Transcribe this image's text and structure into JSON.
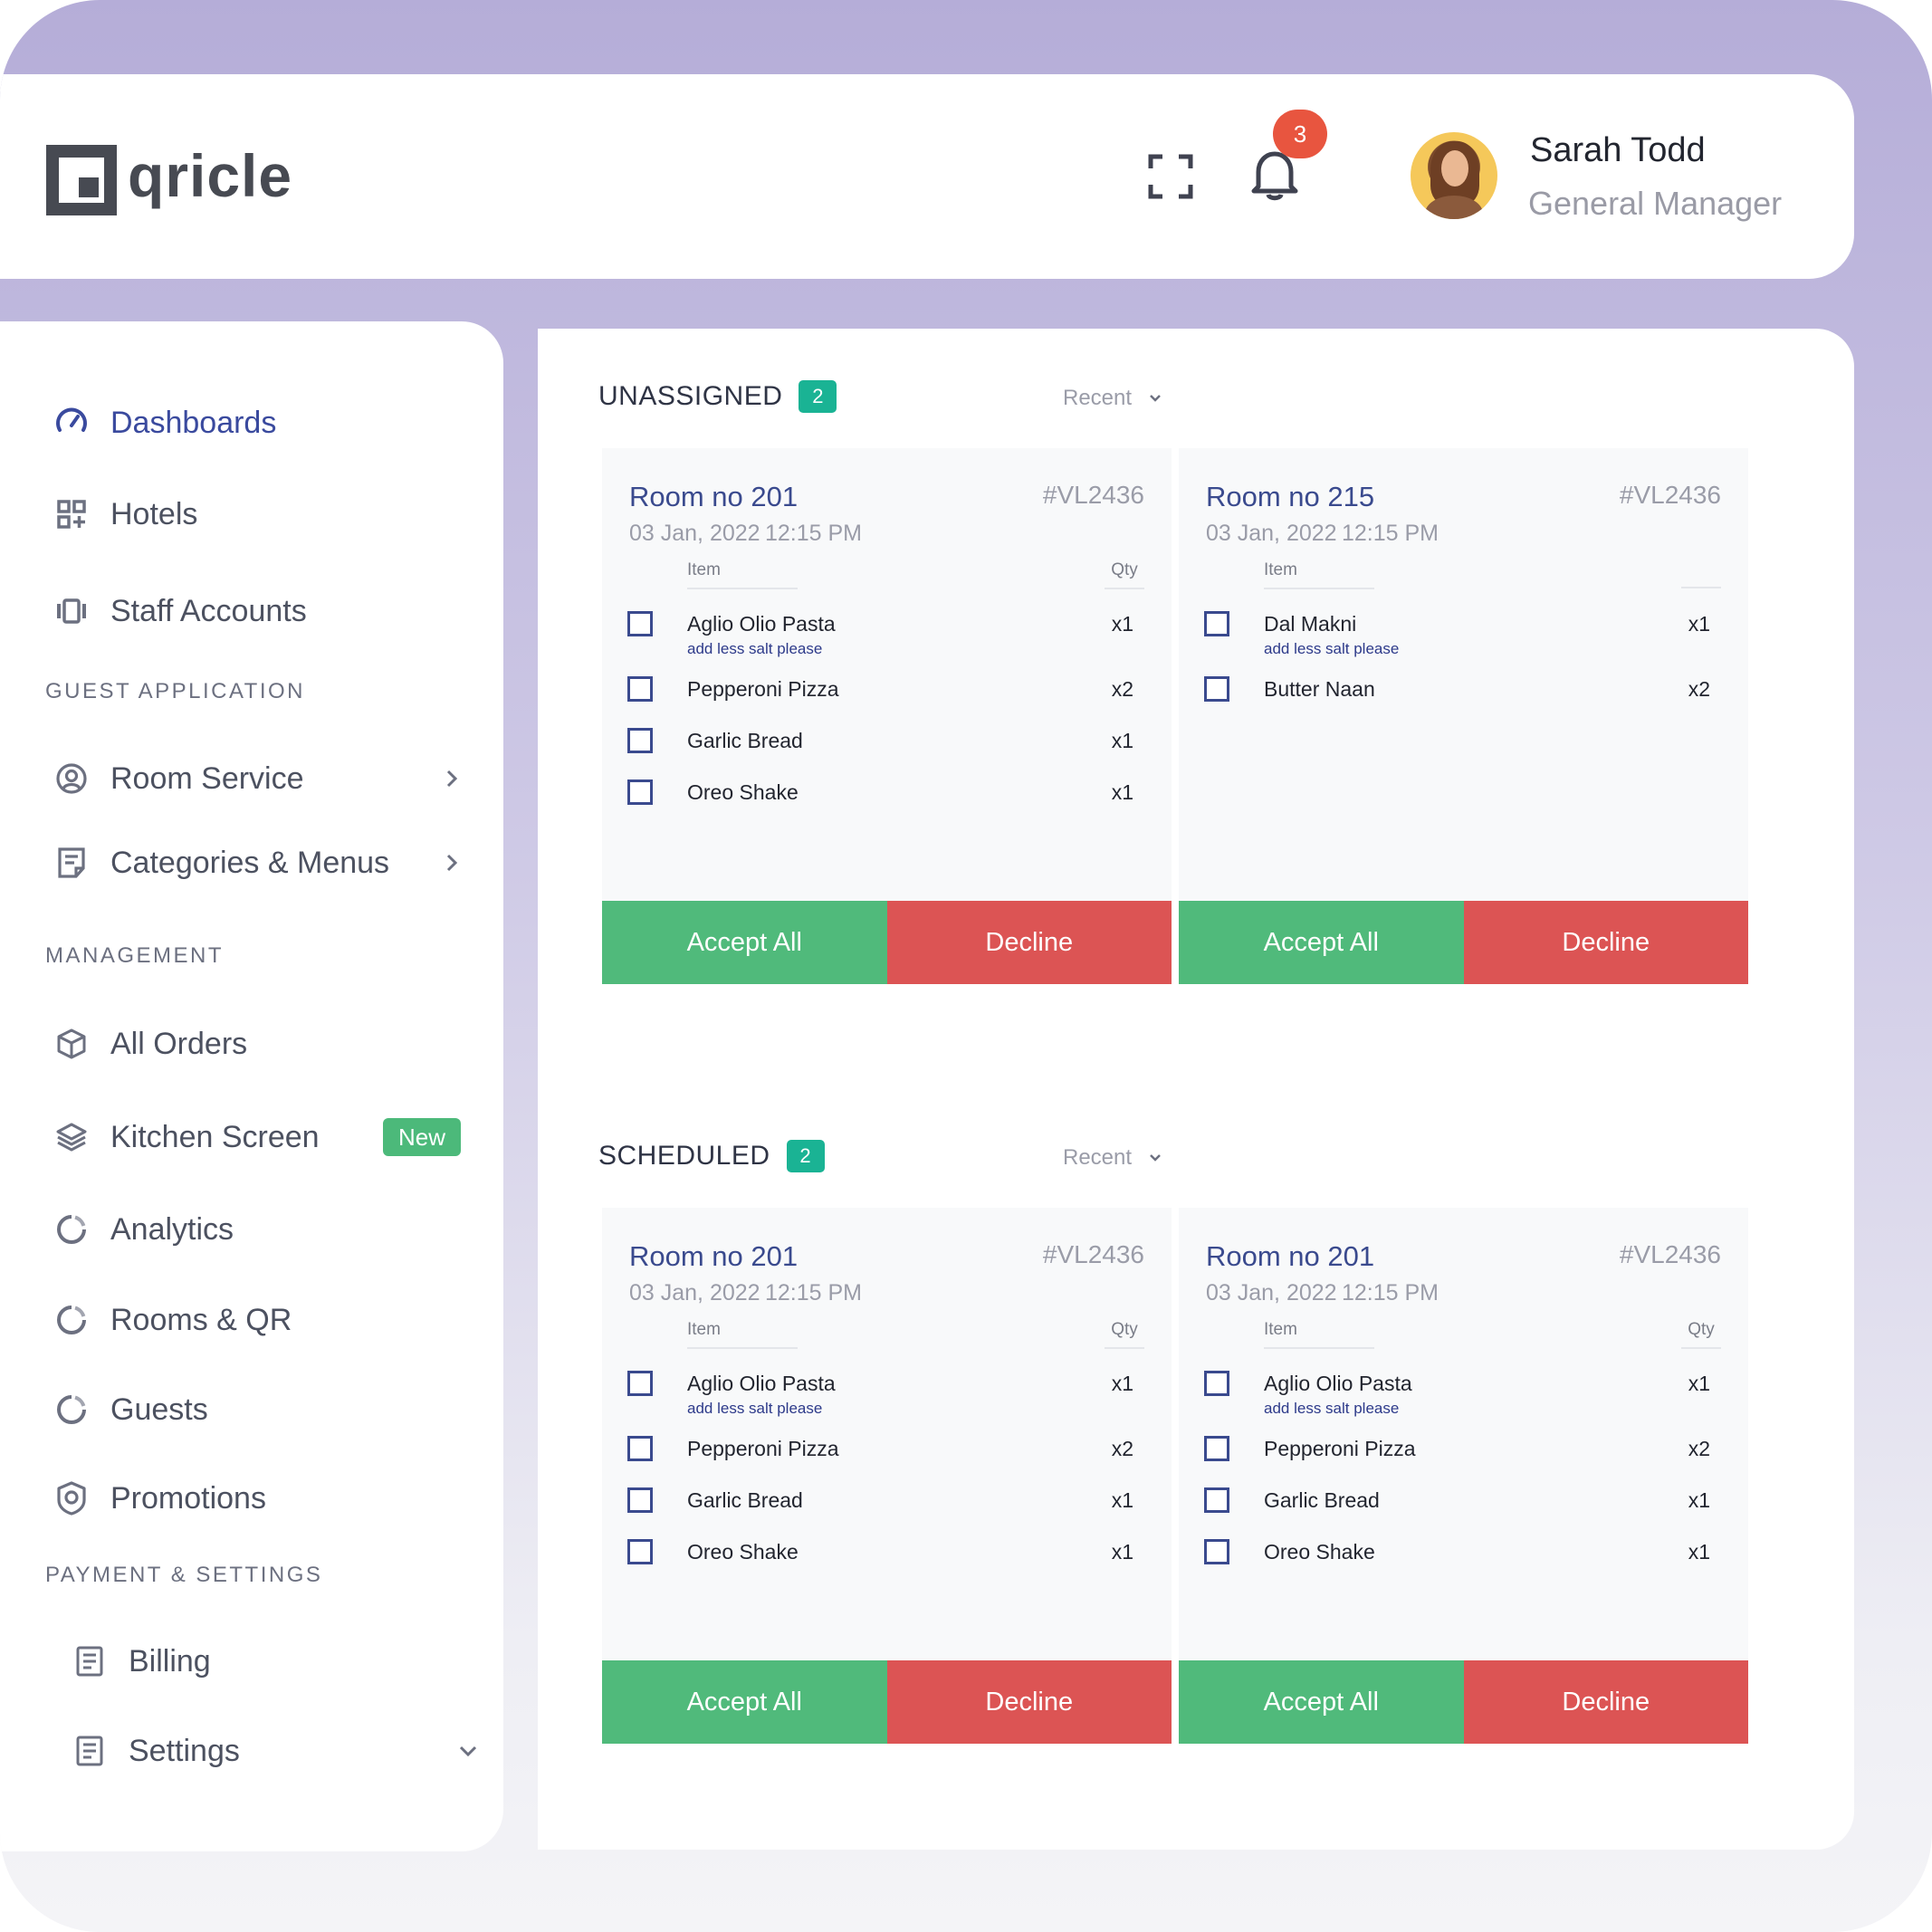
{
  "brand": {
    "name": "qricle"
  },
  "header": {
    "notification_count": "3",
    "user": {
      "name": "Sarah Todd",
      "role": "General Manager"
    }
  },
  "sidebar": {
    "items": [
      {
        "label": "Dashboards",
        "icon": "speedometer-icon",
        "active": true
      },
      {
        "label": "Hotels",
        "icon": "grid-plus-icon"
      },
      {
        "label": "Staff Accounts",
        "icon": "carousel-icon"
      },
      {
        "label": "Room Service",
        "icon": "user-circle-icon"
      },
      {
        "label": "Categories & Menus",
        "icon": "document-icon"
      },
      {
        "label": "All Orders",
        "icon": "box-icon"
      },
      {
        "label": "Kitchen Screen",
        "icon": "layers-icon",
        "badge": "New"
      },
      {
        "label": "Analytics",
        "icon": "donut-icon"
      },
      {
        "label": "Rooms & QR",
        "icon": "donut-icon"
      },
      {
        "label": "Guests",
        "icon": "donut-icon"
      },
      {
        "label": "Promotions",
        "icon": "badge-icon"
      },
      {
        "label": "Billing",
        "icon": "receipt-icon"
      },
      {
        "label": "Settings",
        "icon": "receipt-icon"
      }
    ],
    "sections": {
      "guest_application": "GUEST APPLICATION",
      "management": "MANAGEMENT",
      "payment_settings": "PAYMENT & SETTINGS"
    }
  },
  "main": {
    "sections": [
      {
        "title": "UNASSIGNED",
        "count": "2",
        "sort": "Recent",
        "orders": [
          {
            "room": "Room no 201",
            "code": "#VL2436",
            "date": "03 Jan, 2022",
            "time": "12:15 PM",
            "col_item": "Item",
            "col_qty": "Qty",
            "items": [
              {
                "name": "Aglio Olio Pasta",
                "note": "add less salt please",
                "qty": "x1"
              },
              {
                "name": "Pepperoni Pizza",
                "qty": "x2"
              },
              {
                "name": "Garlic Bread",
                "qty": "x1"
              },
              {
                "name": "Oreo Shake",
                "qty": "x1"
              }
            ],
            "accept": "Accept All",
            "decline": "Decline"
          },
          {
            "room": "Room no 215",
            "code": "#VL2436",
            "date": "03 Jan, 2022",
            "time": "12:15 PM",
            "col_item": "Item",
            "col_qty": "",
            "items": [
              {
                "name": "Dal Makni",
                "note": "add less salt please",
                "qty": "x1"
              },
              {
                "name": "Butter Naan",
                "qty": "x2"
              }
            ],
            "accept": "Accept All",
            "decline": "Decline"
          }
        ]
      },
      {
        "title": "SCHEDULED",
        "count": "2",
        "sort": "Recent",
        "orders": [
          {
            "room": "Room no 201",
            "code": "#VL2436",
            "date": "03 Jan, 2022",
            "time": "12:15 PM",
            "col_item": "Item",
            "col_qty": "Qty",
            "items": [
              {
                "name": "Aglio Olio Pasta",
                "note": "add less salt please",
                "qty": "x1"
              },
              {
                "name": "Pepperoni Pizza",
                "qty": "x2"
              },
              {
                "name": "Garlic Bread",
                "qty": "x1"
              },
              {
                "name": "Oreo Shake",
                "qty": "x1"
              }
            ],
            "accept": "Accept All",
            "decline": "Decline"
          },
          {
            "room": "Room no 201",
            "code": "#VL2436",
            "date": "03 Jan, 2022",
            "time": "12:15 PM",
            "col_item": "Item",
            "col_qty": "Qty",
            "items": [
              {
                "name": "Aglio Olio Pasta",
                "note": "add less salt please",
                "qty": "x1"
              },
              {
                "name": "Pepperoni Pizza",
                "qty": "x2"
              },
              {
                "name": "Garlic Bread",
                "qty": "x1"
              },
              {
                "name": "Oreo Shake",
                "qty": "x1"
              }
            ],
            "accept": "Accept All",
            "decline": "Decline"
          }
        ]
      }
    ]
  },
  "colors": {
    "accent": "#3a4a9e",
    "accept": "#50ba7b",
    "decline": "#dc5454",
    "count_badge": "#1ab394",
    "notification": "#e8553f",
    "new_badge": "#4cb97a"
  }
}
